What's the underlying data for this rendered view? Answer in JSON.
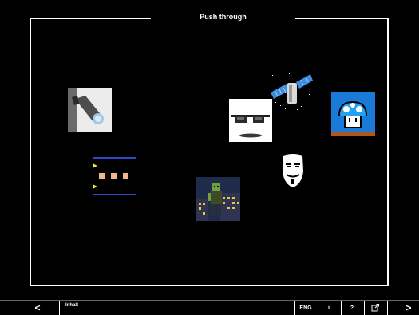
{
  "page": {
    "title": "Push through"
  },
  "toolbar": {
    "prev_label": "<",
    "contents_label": "Inhalt",
    "lang_label": "ENG",
    "info_label": "i",
    "help_label": "?",
    "next_label": ">"
  },
  "thumbnails": [
    {
      "id": "flashlight",
      "name": "flashlight-thumbnail"
    },
    {
      "id": "satellite",
      "name": "satellite-thumbnail"
    },
    {
      "id": "glasses",
      "name": "glasses-thumbnail"
    },
    {
      "id": "mushroom",
      "name": "mushroom-thumbnail"
    },
    {
      "id": "pacman",
      "name": "pacman-thumbnail"
    },
    {
      "id": "mask",
      "name": "mask-thumbnail"
    },
    {
      "id": "zombie",
      "name": "zombie-city-thumbnail"
    }
  ],
  "colors": {
    "background": "#000000",
    "frame": "#ffffff",
    "pacman_blue": "#2f49c9",
    "mushroom_blue": "#1a7ad8"
  }
}
